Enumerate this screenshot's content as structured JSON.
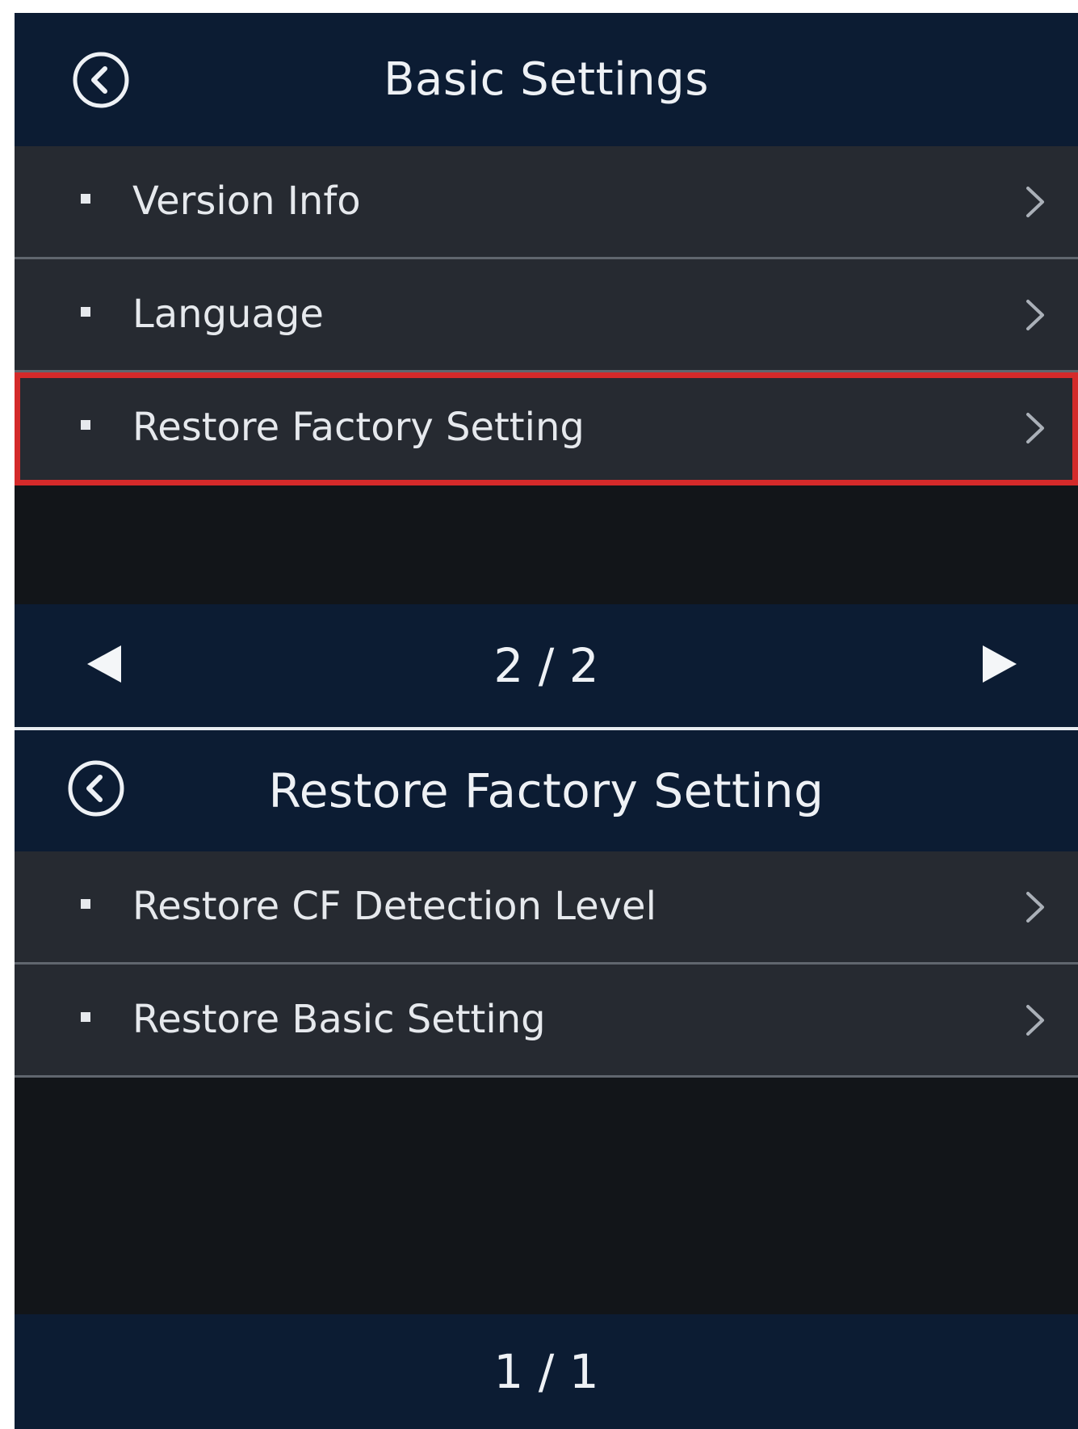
{
  "screen1": {
    "title": "Basic Settings",
    "back_icon": "circle-chevron-left-icon",
    "items": [
      {
        "label": "Version Info",
        "selected": false
      },
      {
        "label": "Language",
        "selected": false
      },
      {
        "label": "Restore Factory Setting",
        "selected": true
      }
    ],
    "pagination": {
      "text": "2 / 2",
      "prev_icon": "triangle-left-icon",
      "next_icon": "triangle-right-icon"
    }
  },
  "screen2": {
    "title": "Restore Factory Setting",
    "back_icon": "circle-chevron-left-icon",
    "items": [
      {
        "label": "Restore CF Detection Level"
      },
      {
        "label": "Restore Basic Setting"
      }
    ],
    "pagination": {
      "text": "1 / 1"
    }
  },
  "colors": {
    "header_bg": "#0c1c33",
    "item_bg": "#262a31",
    "content_bg": "#121519",
    "highlight": "#d42a2a",
    "text": "#e6e9ed"
  }
}
